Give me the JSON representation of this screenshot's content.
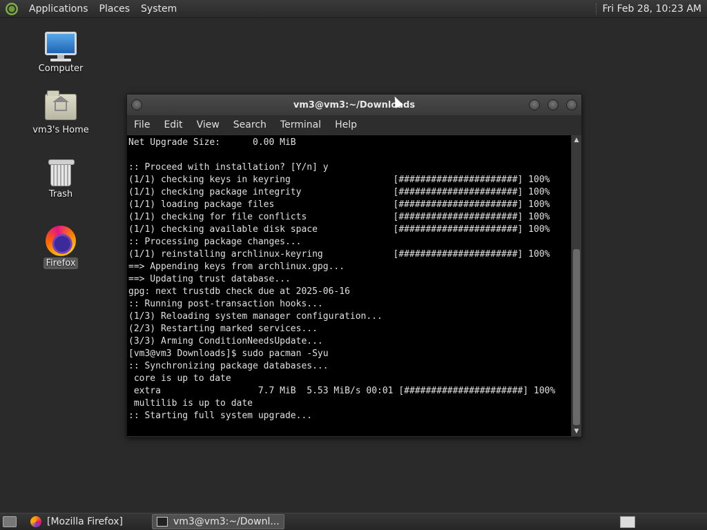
{
  "top_panel": {
    "menus": [
      "Applications",
      "Places",
      "System"
    ],
    "clock": "Fri Feb 28, 10:23 AM"
  },
  "desktop": {
    "icons": [
      {
        "label": "Computer",
        "icon": "computer-icon"
      },
      {
        "label": "vm3's Home",
        "icon": "home-folder-icon"
      },
      {
        "label": "Trash",
        "icon": "trash-icon"
      },
      {
        "label": "Firefox",
        "icon": "firefox-icon",
        "selected": true
      }
    ]
  },
  "terminal": {
    "title": "vm3@vm3:~/Downloads",
    "menu": [
      "File",
      "Edit",
      "View",
      "Search",
      "Terminal",
      "Help"
    ],
    "lines": [
      "Net Upgrade Size:      0.00 MiB",
      "",
      ":: Proceed with installation? [Y/n] y",
      "(1/1) checking keys in keyring                   [######################] 100%",
      "(1/1) checking package integrity                 [######################] 100%",
      "(1/1) loading package files                      [######################] 100%",
      "(1/1) checking for file conflicts                [######################] 100%",
      "(1/1) checking available disk space              [######################] 100%",
      ":: Processing package changes...",
      "(1/1) reinstalling archlinux-keyring             [######################] 100%",
      "==> Appending keys from archlinux.gpg...",
      "==> Updating trust database...",
      "gpg: next trustdb check due at 2025-06-16",
      ":: Running post-transaction hooks...",
      "(1/3) Reloading system manager configuration...",
      "(2/3) Restarting marked services...",
      "(3/3) Arming ConditionNeedsUpdate...",
      "[vm3@vm3 Downloads]$ sudo pacman -Syu",
      ":: Synchronizing package databases...",
      " core is up to date",
      " extra                  7.7 MiB  5.53 MiB/s 00:01 [######################] 100%",
      " multilib is up to date",
      ":: Starting full system upgrade..."
    ]
  },
  "taskbar": {
    "tasks": [
      {
        "label": "[Mozilla Firefox]",
        "icon": "firefox-icon",
        "active": false
      },
      {
        "label": "vm3@vm3:~/Downl...",
        "icon": "terminal-icon",
        "active": true
      }
    ]
  }
}
